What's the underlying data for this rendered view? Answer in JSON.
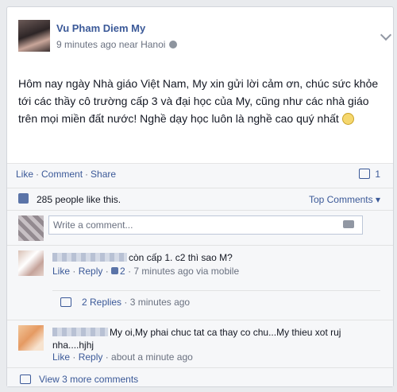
{
  "post": {
    "author": "Vu Pham Diem My",
    "time": "9 minutes ago near Hanoi",
    "body": "Hôm nay ngày Nhà giáo Việt Nam, My xin gửi lời cảm ơn, chúc sức khỏe tới các thầy cô trường cấp 3 và đại học của My, cũng như các nhà giáo trên mọi miền đất nước! Nghề dạy học luôn là nghề cao quý nhất"
  },
  "actions": {
    "like": "Like",
    "comment": "Comment",
    "share": "Share",
    "comment_count": "1"
  },
  "likes": {
    "text": "285 people like this.",
    "sort": "Top Comments ▾"
  },
  "write": {
    "placeholder": "Write a comment..."
  },
  "comments": [
    {
      "text": "còn cấp 1. c2 thì sao M?",
      "like": "Like",
      "reply": "Reply",
      "likes": "2",
      "time": "7 minutes ago via mobile",
      "replies": "2 Replies",
      "replies_time": "3 minutes ago"
    },
    {
      "text": "My oi,My phai chuc tat ca thay co chu...My thieu xot ruj nha....hjhj",
      "like": "Like",
      "reply": "Reply",
      "time": "about a minute ago"
    }
  ],
  "view_more": "View 3 more comments"
}
